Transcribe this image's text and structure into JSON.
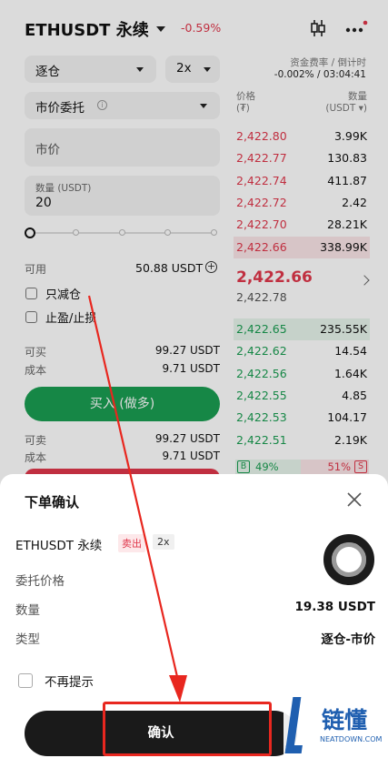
{
  "header": {
    "symbol": "ETHUSDT 永续",
    "change": "-0.59%"
  },
  "funding": {
    "label": "资金费率 / 倒计时",
    "value": "-0.002% / 03:04:41"
  },
  "controls": {
    "margin_mode": "逐仓",
    "leverage": "2x",
    "order_type": "市价委托",
    "price_placeholder": "市价",
    "qty_label": "数量 (USDT)",
    "qty_value": "20"
  },
  "slider": {
    "value": 0
  },
  "available": {
    "label": "可用",
    "value": "50.88 USDT"
  },
  "options": {
    "reduce_only": "只减仓",
    "tp_sl": "止盈/止损"
  },
  "buy": {
    "can_buy_label": "可买",
    "can_buy_value": "99.27 USDT",
    "cost_label": "成本",
    "cost_value": "9.71 USDT",
    "button": "买入 (做多)"
  },
  "sell": {
    "can_sell_label": "可卖",
    "can_sell_value": "99.27 USDT",
    "cost_label": "成本",
    "cost_value": "9.71 USDT"
  },
  "orderbook": {
    "price_header": "价格",
    "price_unit": "(₮)",
    "qty_header": "数量",
    "qty_unit": "(USDT ▾)",
    "asks": [
      {
        "price": "2,422.80",
        "amount": "3.99K"
      },
      {
        "price": "2,422.77",
        "amount": "130.83"
      },
      {
        "price": "2,422.74",
        "amount": "411.87"
      },
      {
        "price": "2,422.72",
        "amount": "2.42"
      },
      {
        "price": "2,422.70",
        "amount": "28.21K"
      },
      {
        "price": "2,422.66",
        "amount": "338.99K"
      }
    ],
    "last_price": "2,422.66",
    "mark_price": "2,422.78",
    "bids": [
      {
        "price": "2,422.65",
        "amount": "235.55K"
      },
      {
        "price": "2,422.62",
        "amount": "14.54"
      },
      {
        "price": "2,422.56",
        "amount": "1.64K"
      },
      {
        "price": "2,422.55",
        "amount": "4.85"
      },
      {
        "price": "2,422.53",
        "amount": "104.17"
      },
      {
        "price": "2,422.51",
        "amount": "2.19K"
      }
    ],
    "buy_tag": "B",
    "buy_ratio": "49%",
    "sell_ratio": "51%",
    "sell_tag": "S"
  },
  "dialog": {
    "title": "下单确认",
    "symbol": "ETHUSDT 永续",
    "side": "卖出",
    "leverage": "2x",
    "order_price_label": "委托价格",
    "qty_label": "数量",
    "qty_value": "19.38 USDT",
    "type_label": "类型",
    "type_value": "逐仓-市价",
    "no_remind": "不再提示",
    "confirm": "确认"
  },
  "watermark": {
    "text": "链懂",
    "sub": "NEATDOWN.COM"
  },
  "colors": {
    "red": "#e0374b",
    "green": "#1a9e52",
    "annotation": "#e8271f"
  }
}
